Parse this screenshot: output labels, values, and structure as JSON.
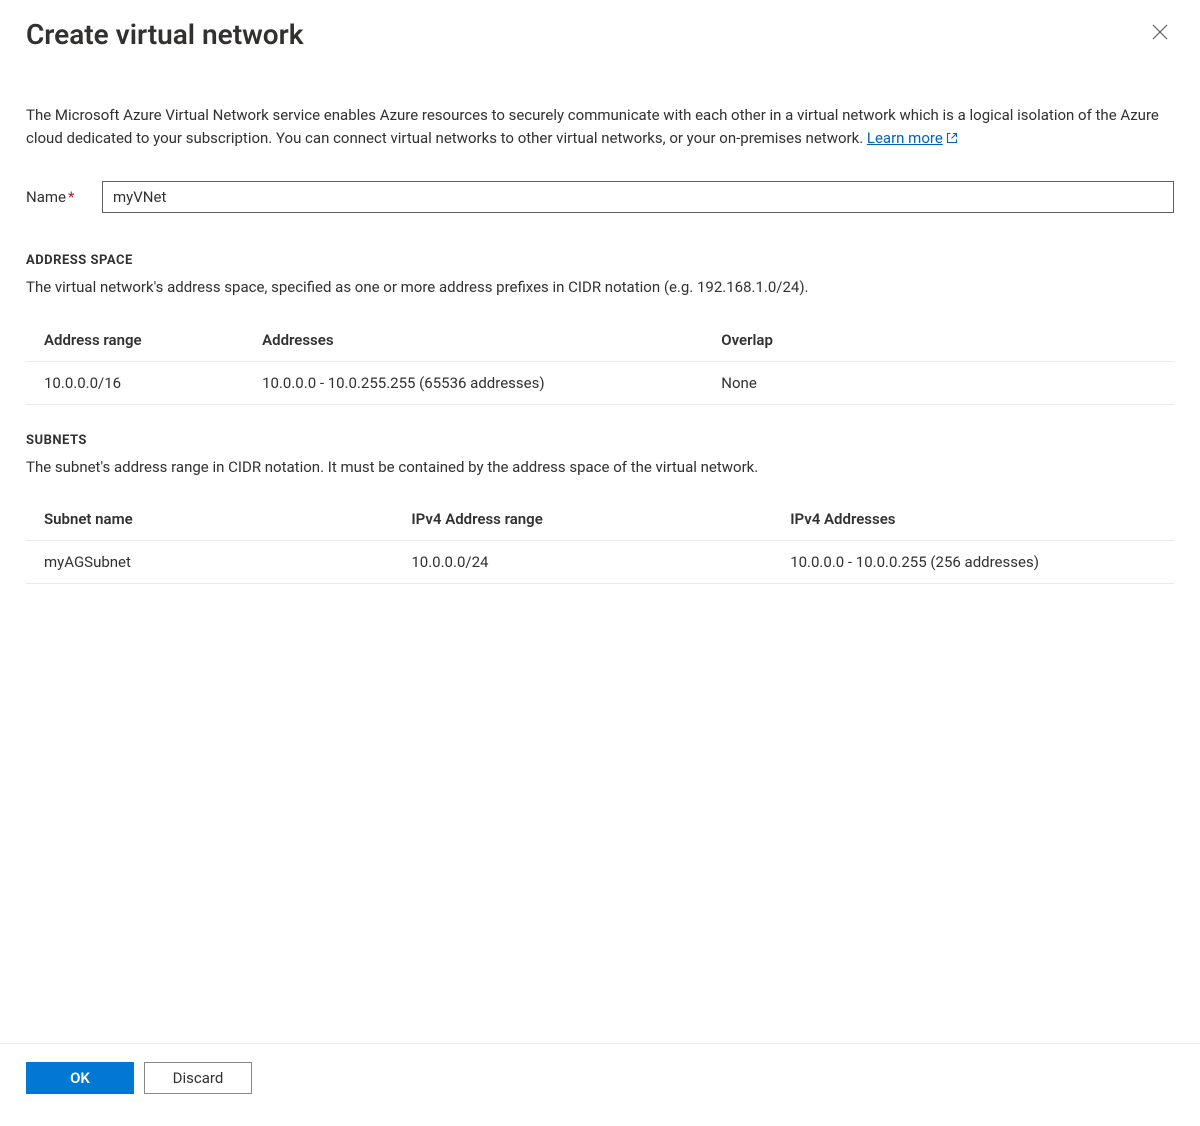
{
  "header": {
    "title": "Create virtual network"
  },
  "intro": {
    "text": "The Microsoft Azure Virtual Network service enables Azure resources to securely communicate with each other in a virtual network which is a logical isolation of the Azure cloud dedicated to your subscription. You can connect virtual networks to other virtual networks, or your on-premises network.  ",
    "learn_more": "Learn more"
  },
  "form": {
    "name_label": "Name",
    "name_value": "myVNet"
  },
  "address_space": {
    "section_title": "ADDRESS SPACE",
    "section_desc": "The virtual network's address space, specified as one or more address prefixes in CIDR notation (e.g. 192.168.1.0/24).",
    "columns": {
      "range": "Address range",
      "addresses": "Addresses",
      "overlap": "Overlap"
    },
    "rows": [
      {
        "range": "10.0.0.0/16",
        "addresses": "10.0.0.0 - 10.0.255.255 (65536 addresses)",
        "overlap": "None"
      }
    ]
  },
  "subnets": {
    "section_title": "SUBNETS",
    "section_desc": "The subnet's address range in CIDR notation. It must be contained by the address space of the virtual network.",
    "columns": {
      "name": "Subnet name",
      "range": "IPv4 Address range",
      "addresses": "IPv4 Addresses"
    },
    "rows": [
      {
        "name": "myAGSubnet",
        "range": "10.0.0.0/24",
        "addresses": "10.0.0.0 - 10.0.0.255 (256 addresses)"
      }
    ]
  },
  "footer": {
    "ok": "OK",
    "discard": "Discard"
  }
}
